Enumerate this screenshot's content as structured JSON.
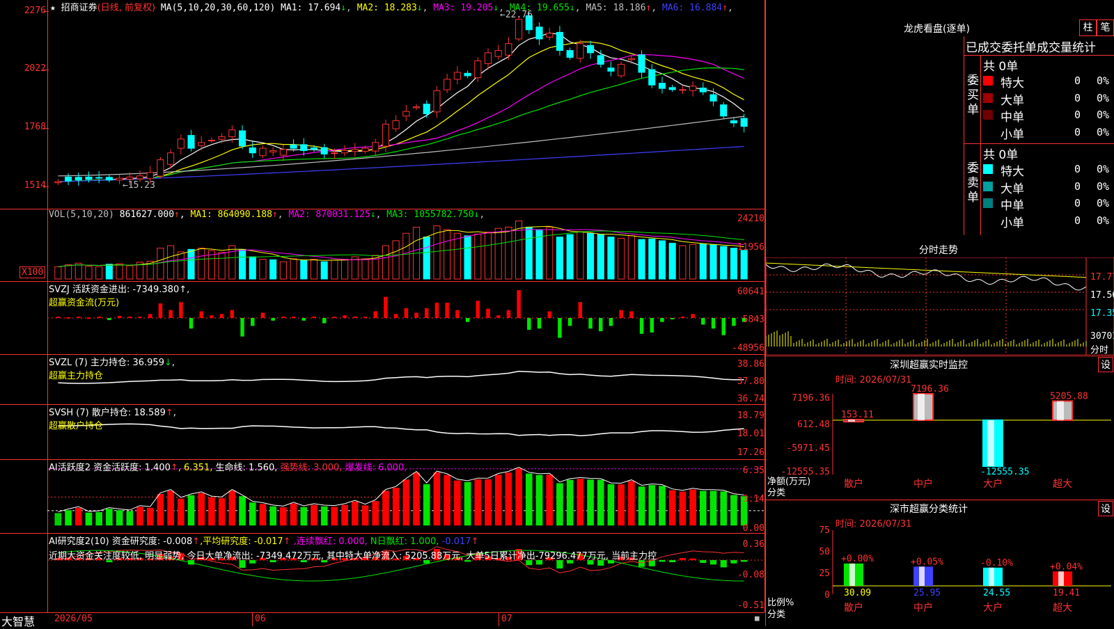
{
  "stock": {
    "star": "★",
    "name": "招商证券",
    "mode": "(日线, 前复权)",
    "ma_params": "MA(5,10,20,30,60,120)",
    "ma": [
      {
        "label": "MA1:",
        "value": "17.694",
        "arrow": "↓",
        "color": "#ffffff"
      },
      {
        "label": "MA2:",
        "value": "18.283",
        "arrow": "↓",
        "color": "#ffff00"
      },
      {
        "label": "MA3:",
        "value": "19.205",
        "arrow": "↓",
        "color": "#ff00ff"
      },
      {
        "label": "MA4:",
        "value": "19.655",
        "arrow": "↓",
        "color": "#00e600"
      },
      {
        "label": "MA5:",
        "value": "18.186",
        "arrow": "↑",
        "color": "#c0c0c0"
      },
      {
        "label": "MA6:",
        "value": "16.884",
        "arrow": "↑",
        "color": "#4040ff"
      }
    ],
    "y_labels": [
      "2276",
      "2022",
      "1768",
      "1514"
    ],
    "high_label": "22.76",
    "low_label": "15.23"
  },
  "vol": {
    "params": "VOL(5,10,20)",
    "value": "861627.000",
    "value_arrow": "↑",
    "ma": [
      {
        "label": "MA1:",
        "value": "864090.188",
        "arrow": "↑",
        "color": "#ffff00"
      },
      {
        "label": "MA2:",
        "value": "870031.125",
        "arrow": "↓",
        "color": "#ff00ff"
      },
      {
        "label": "MA3:",
        "value": "1055782.750",
        "arrow": "↓",
        "color": "#00e600"
      }
    ],
    "y_labels": [
      "24210",
      "11956"
    ],
    "unit": "X100"
  },
  "svzj": {
    "title": "SVZJ  活跃资金进出: -7349.380↑,",
    "subtitle": "超赢资金流(万元)",
    "y_labels": [
      "60641",
      "5843",
      "-48956"
    ]
  },
  "svzl": {
    "title": "SVZL (7) 主力持仓: 36.959",
    "arrow": "↓",
    "tail": ",",
    "subtitle": "超赢主力持仓",
    "y_labels": [
      "38.86",
      "37.80",
      "36.74"
    ]
  },
  "svsh": {
    "title": "SVSH (7) 散户持仓: 18.589",
    "arrow": "↑",
    "tail": ",",
    "subtitle": "超赢散户持仓",
    "y_labels": [
      "18.79",
      "18.01",
      "17.26"
    ]
  },
  "ai_active": {
    "name": "AI活跃度2",
    "l1": "资金活跃度: 1.400",
    "l1a": "↑",
    "l2": ", 6.351,",
    "l3": "生命线: 1.560,",
    "l4": "强势线: 3.000,",
    "l5": "爆发线: 6.000,",
    "y_labels": [
      "6.35",
      "3.14",
      "0.00"
    ]
  },
  "ai_research": {
    "name": "AI研究度2(10)",
    "l1": "资金研究度: -0.008",
    "l1a": "↑",
    "l2": ",平均研究度: -0.017",
    "l2a": "↑",
    "l3": ",连续飘红: 0.000,",
    "l4": "N日飘红: 1.000,",
    "l5": "-0.017",
    "l5a": "↑",
    "commentary": "近期大资金关注度较低, 明显弱势, 今日大单净流出: -7349.472万元, 其中特大单净流入: 5205.88万元, 大单5日累计净出-79296.477万元, 当前主力控",
    "y_labels": [
      "0.36",
      "-0.08",
      "-0.51"
    ]
  },
  "x_axis": {
    "brand": "大智慧",
    "labels": [
      "2026/05",
      "06",
      "07"
    ]
  },
  "right_panel": {
    "header": "龙虎看盘(逐单)",
    "tab_bar": "柱",
    "tab_pen": "笔",
    "order_title": "已成交委托单成交量统计",
    "buy": {
      "label": "委买单",
      "total": "共 0单",
      "rows": [
        {
          "name": "特大",
          "count": "0",
          "pct": "0%",
          "color": "#ff0000"
        },
        {
          "name": "大单",
          "count": "0",
          "pct": "0%",
          "color": "#a00000"
        },
        {
          "name": "中单",
          "count": "0",
          "pct": "0%",
          "color": "#700000"
        },
        {
          "name": "小单",
          "count": "0",
          "pct": "0%",
          "color": ""
        }
      ]
    },
    "sell": {
      "label": "委卖单",
      "total": "共 0单",
      "rows": [
        {
          "name": "特大",
          "count": "0",
          "pct": "0%",
          "color": "#00ffff"
        },
        {
          "name": "大单",
          "count": "0",
          "pct": "0%",
          "color": "#00a0a0"
        },
        {
          "name": "中单",
          "count": "0",
          "pct": "0%",
          "color": "#008080"
        },
        {
          "name": "小单",
          "count": "0",
          "pct": "0%",
          "color": ""
        }
      ]
    },
    "minute": {
      "title": "分时走势",
      "y_labels": [
        "17.77",
        "17.56",
        "17.35"
      ],
      "vol_label": "30701",
      "vol_word": "分时"
    },
    "sz_monitor": {
      "title": "深圳超赢实时监控",
      "settings": "设",
      "time": "时间: 2026/07/31",
      "y_labels": [
        "7196.36",
        "612.48",
        "-5971.45",
        "-12555.35"
      ],
      "axis_unit": "净额(万元)",
      "axis_cat": "分类",
      "categories": [
        "散户",
        "中户",
        "大户",
        "超大"
      ],
      "values": [
        153.11,
        7196.36,
        -12555.35,
        5205.88
      ],
      "value_labels": [
        "153.11",
        "7196.36",
        "-12555.35",
        "5205.88"
      ]
    },
    "sz_class": {
      "title": "深市超赢分类统计",
      "settings": "设",
      "time": "时间: 2026/07/31",
      "y_labels": [
        "75",
        "50",
        "25",
        "0"
      ],
      "axis_unit": "比例%",
      "axis_cat": "分类",
      "categories": [
        "散户",
        "中户",
        "大户",
        "超大"
      ],
      "values": [
        30.09,
        25.95,
        24.55,
        19.41
      ],
      "value_labels": [
        "30.09",
        "25.95",
        "24.55",
        "19.41"
      ],
      "change_labels": [
        "+0.00%",
        "+0.05%",
        "-0.10%",
        "+0.04%"
      ]
    }
  },
  "chart_data": [
    {
      "type": "candlestick",
      "title": "招商证券 (日线, 前复权)",
      "x_range": [
        "2026/05",
        "2026/07"
      ],
      "ylim": [
        15.14,
        22.76
      ],
      "high": 22.76,
      "low": 15.23,
      "close": [
        15.35,
        15.38,
        15.43,
        15.45,
        15.5,
        15.42,
        15.5,
        15.55,
        15.6,
        15.75,
        16.3,
        16.6,
        17.2,
        16.8,
        17.05,
        17.15,
        17.3,
        17.6,
        16.9,
        16.6,
        16.8,
        16.7,
        16.75,
        16.8,
        16.7,
        16.75,
        16.55,
        16.6,
        16.7,
        16.75,
        16.8,
        17.05,
        17.85,
        18.0,
        18.4,
        18.6,
        18.3,
        19.3,
        19.8,
        20.1,
        19.95,
        20.6,
        20.95,
        21.05,
        21.35,
        22.4,
        21.95,
        21.55,
        21.8,
        21.05,
        20.75,
        21.35,
        20.95,
        20.45,
        20.15,
        20.45,
        20.7,
        20.1,
        19.55,
        19.4,
        19.35,
        19.35,
        19.5,
        19.25,
        18.85,
        18.2,
        17.9,
        17.75
      ],
      "volume": [
        5000,
        5800,
        6400,
        5200,
        5000,
        6000,
        6200,
        5400,
        6800,
        7200,
        12500,
        13500,
        11000,
        12000,
        12500,
        11500,
        10800,
        13500,
        12000,
        9000,
        8000,
        7800,
        7000,
        8200,
        7500,
        8000,
        7000,
        7600,
        8000,
        9000,
        8200,
        9600,
        13500,
        15500,
        18500,
        21000,
        17000,
        21500,
        20000,
        18500,
        17500,
        18200,
        19000,
        20500,
        21000,
        23500,
        21000,
        20000,
        21000,
        17000,
        18000,
        19200,
        18500,
        18000,
        17000,
        16500,
        17500,
        16000,
        16200,
        15500,
        14500,
        13500,
        14000,
        14200,
        13800,
        13200,
        12500,
        11600
      ]
    },
    {
      "type": "bar",
      "title": "深圳超赢实时监控",
      "categories": [
        "散户",
        "中户",
        "大户",
        "超大"
      ],
      "values": [
        153.11,
        7196.36,
        -12555.35,
        5205.88
      ],
      "ylabel": "净额(万元)",
      "ylim": [
        -12555.35,
        7196.36
      ]
    },
    {
      "type": "bar",
      "title": "深市超赢分类统计",
      "categories": [
        "散户",
        "中户",
        "大户",
        "超大"
      ],
      "values": [
        30.09,
        25.95,
        24.55,
        19.41
      ],
      "ylabel": "比例%",
      "ylim": [
        0,
        75
      ]
    }
  ]
}
